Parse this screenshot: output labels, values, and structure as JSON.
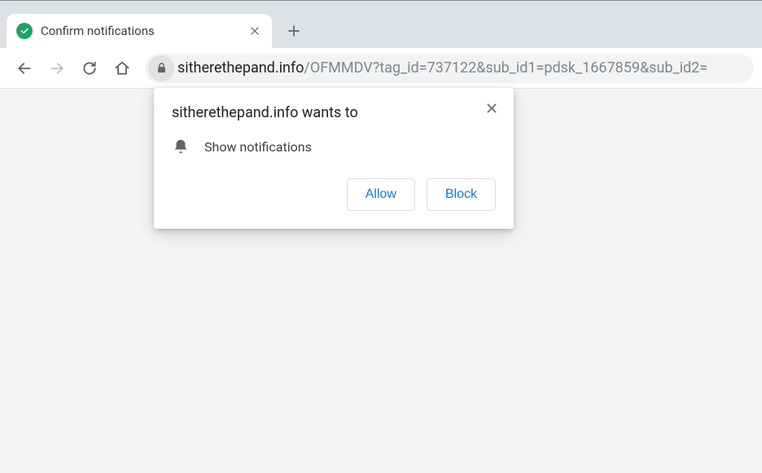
{
  "tab": {
    "title": "Confirm notifications"
  },
  "address": {
    "domain": "sitherethepand.info",
    "path": "/OFMMDV?tag_id=737122&sub_id1=pdsk_1667859&sub_id2="
  },
  "dialog": {
    "title": "sitherethepand.info wants to",
    "permission_label": "Show notifications",
    "allow_label": "Allow",
    "block_label": "Block"
  }
}
